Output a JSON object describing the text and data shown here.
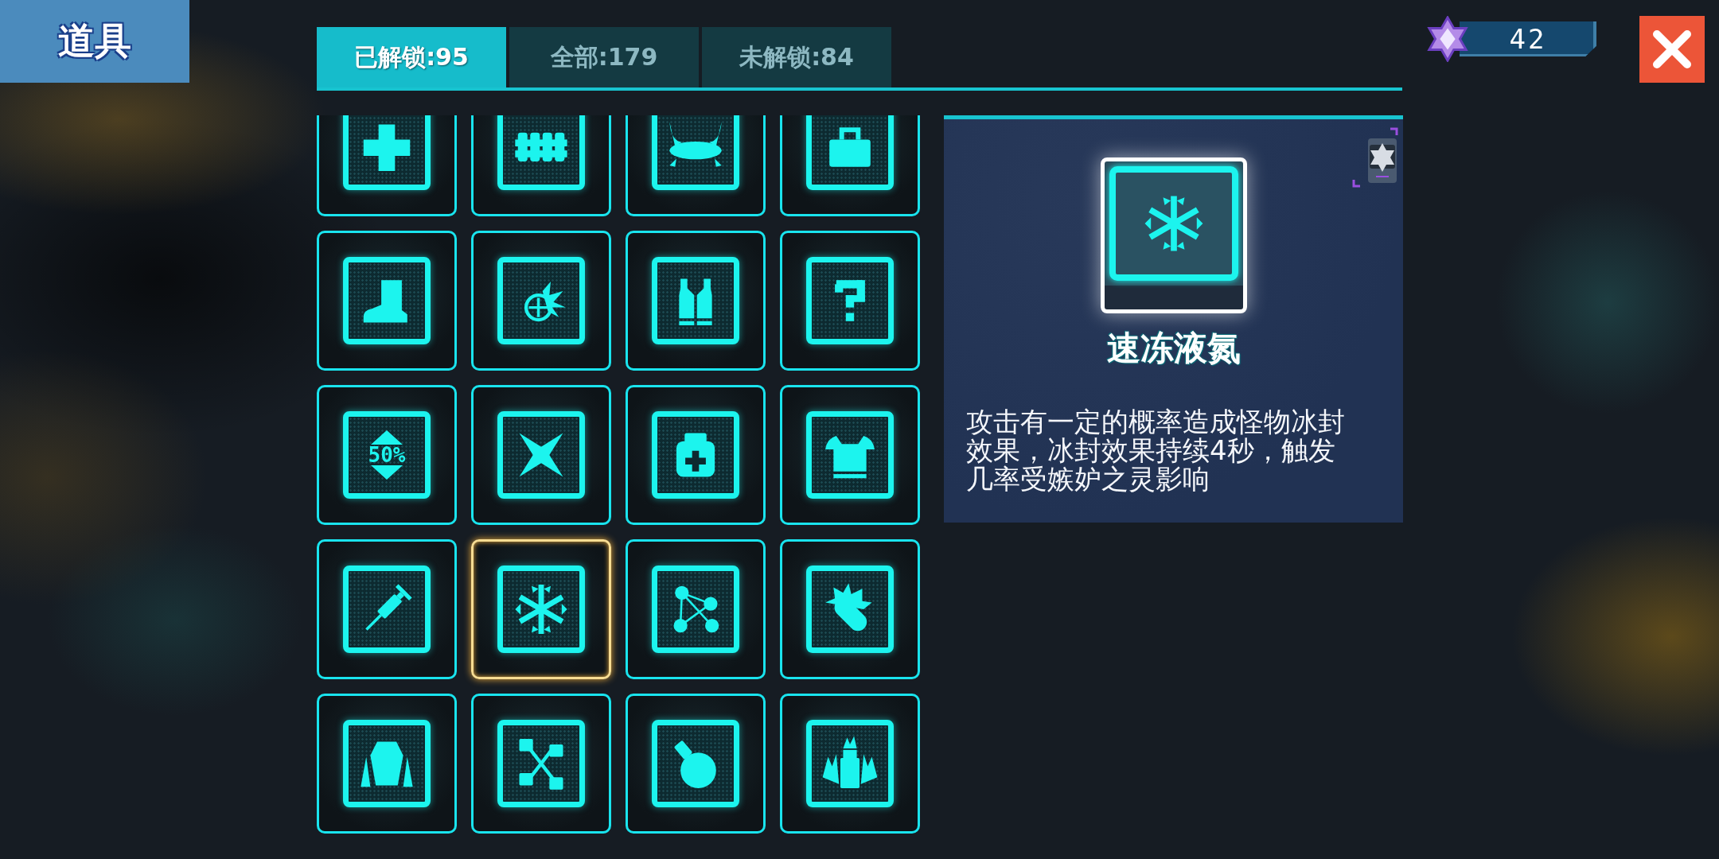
{
  "title": "道具",
  "tabs": [
    {
      "label": "已解锁:95",
      "selected": true
    },
    {
      "label": "全部:179",
      "selected": false
    },
    {
      "label": "未解锁:84",
      "selected": false
    }
  ],
  "currency": {
    "amount": "42"
  },
  "items": [
    {
      "selected": false
    },
    {
      "selected": false
    },
    {
      "selected": false
    },
    {
      "selected": false
    },
    {
      "selected": false
    },
    {
      "selected": false
    },
    {
      "selected": false
    },
    {
      "selected": false
    },
    {
      "selected": false,
      "label": "50%"
    },
    {
      "selected": false
    },
    {
      "selected": false
    },
    {
      "selected": false
    },
    {
      "selected": false
    },
    {
      "selected": true
    },
    {
      "selected": false
    },
    {
      "selected": false
    },
    {
      "selected": false
    },
    {
      "selected": false
    },
    {
      "selected": false
    },
    {
      "selected": false
    }
  ],
  "detail": {
    "name": "速冻液氮",
    "description": "攻击有一定的概率造成怪物冰封效果，冰封效果持续4秒，触发几率受嫉妒之灵影响"
  }
}
